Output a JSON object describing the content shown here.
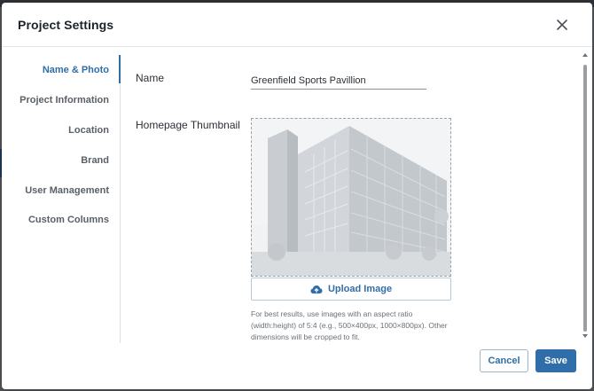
{
  "modal": {
    "title": "Project Settings"
  },
  "sidebar": {
    "items": [
      {
        "label": "Name & Photo",
        "active": true
      },
      {
        "label": "Project Information",
        "active": false
      },
      {
        "label": "Location",
        "active": false
      },
      {
        "label": "Brand",
        "active": false
      },
      {
        "label": "User Management",
        "active": false
      },
      {
        "label": "Custom Columns",
        "active": false
      }
    ]
  },
  "form": {
    "name_label": "Name",
    "name_value": "Greenfield Sports Pavillion",
    "thumbnail_label": "Homepage Thumbnail",
    "upload_label": "Upload Image",
    "hint": "For best results, use images with an aspect ratio (width:height) of 5:4 (e.g., 500×400px, 1000×800px). Other dimensions will be cropped to fit."
  },
  "footer": {
    "cancel_label": "Cancel",
    "save_label": "Save"
  },
  "colors": {
    "accent": "#2f6ea8",
    "title": "#1e2329"
  },
  "icons": {
    "close": "close-icon",
    "upload": "cloud-upload-icon"
  }
}
